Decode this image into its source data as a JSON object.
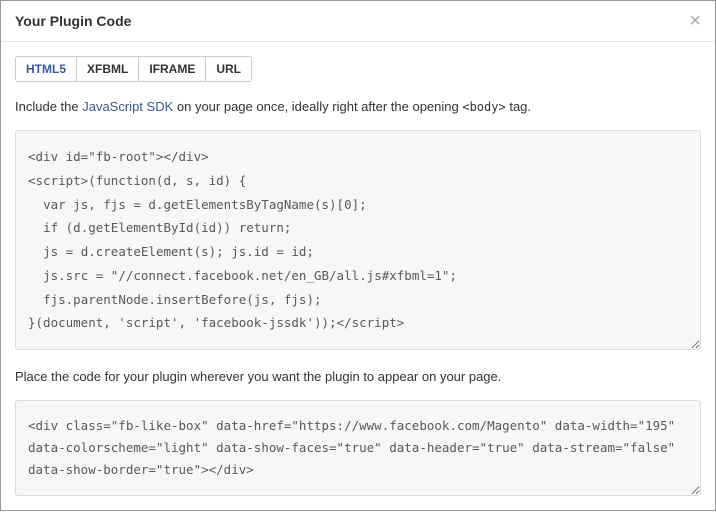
{
  "header": {
    "title": "Your Plugin Code",
    "close": "×"
  },
  "tabs": [
    {
      "label": "HTML5",
      "active": true
    },
    {
      "label": "XFBML",
      "active": false
    },
    {
      "label": "IFRAME",
      "active": false
    },
    {
      "label": "URL",
      "active": false
    }
  ],
  "instruction1": {
    "pre": "Include the ",
    "link": "JavaScript SDK",
    "mid": " on your page once, ideally right after the opening ",
    "code": "<body>",
    "post": " tag."
  },
  "code1": "<div id=\"fb-root\"></div>\n<script>(function(d, s, id) {\n  var js, fjs = d.getElementsByTagName(s)[0];\n  if (d.getElementById(id)) return;\n  js = d.createElement(s); js.id = id;\n  js.src = \"//connect.facebook.net/en_GB/all.js#xfbml=1\";\n  fjs.parentNode.insertBefore(js, fjs);\n}(document, 'script', 'facebook-jssdk'));</script>",
  "instruction2": "Place the code for your plugin wherever you want the plugin to appear on your page.",
  "code2": "<div class=\"fb-like-box\" data-href=\"https://www.facebook.com/Magento\" data-width=\"195\" data-colorscheme=\"light\" data-show-faces=\"true\" data-header=\"true\" data-stream=\"false\" data-show-border=\"true\"></div>"
}
